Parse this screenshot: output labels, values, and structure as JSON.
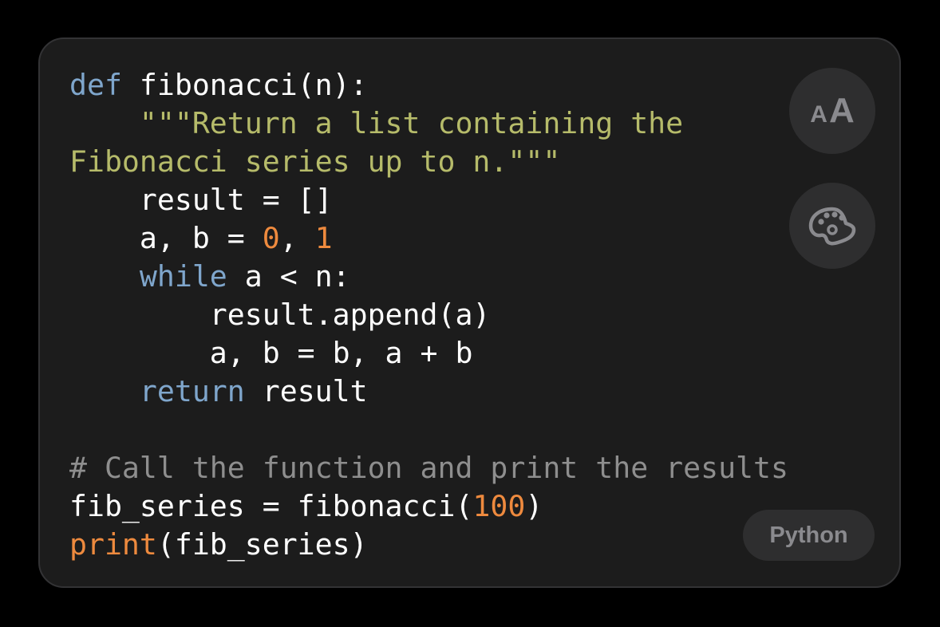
{
  "language_badge": "Python",
  "buttons": {
    "font_size": "text-size-icon",
    "theme": "palette-icon"
  },
  "font_icon_text": {
    "small": "A",
    "large": "A"
  },
  "colors": {
    "keyword": "#7fa6cc",
    "string": "#b6bb6a",
    "number": "#ee8a3e",
    "comment": "#8e8e8e",
    "text": "#ffffff",
    "background": "#1c1c1c"
  },
  "code_lines": [
    [
      [
        "def",
        "kw"
      ],
      [
        " fibonacci(n):",
        ""
      ]
    ],
    [
      [
        "    \"\"\"Return a list containing the",
        "str"
      ]
    ],
    [
      [
        "Fibonacci series up to n.\"\"\"",
        "str"
      ]
    ],
    [
      [
        "    result = []",
        ""
      ]
    ],
    [
      [
        "    a, b = ",
        ""
      ],
      [
        "0",
        "num"
      ],
      [
        ", ",
        ""
      ],
      [
        "1",
        "num"
      ]
    ],
    [
      [
        "    ",
        ""
      ],
      [
        "while",
        "kw"
      ],
      [
        " a < n:",
        ""
      ]
    ],
    [
      [
        "        result.append(a)",
        ""
      ]
    ],
    [
      [
        "        a, b = b, a + b",
        ""
      ]
    ],
    [
      [
        "    ",
        ""
      ],
      [
        "return",
        "kw"
      ],
      [
        " result",
        ""
      ]
    ],
    [
      [
        "",
        ""
      ]
    ],
    [
      [
        "# Call the function and print the results",
        "com"
      ]
    ],
    [
      [
        "fib_series = fibonacci(",
        ""
      ],
      [
        "100",
        "num"
      ],
      [
        ")",
        ""
      ]
    ],
    [
      [
        "print",
        "fn"
      ],
      [
        "(fib_series)",
        ""
      ]
    ]
  ]
}
